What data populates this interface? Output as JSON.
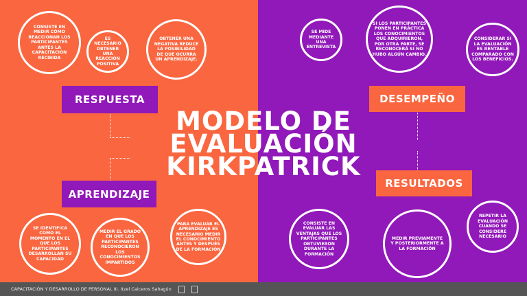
{
  "title": [
    "MODELO DE",
    "EVALUACIÓN",
    "KIRKPATRICK"
  ],
  "labels": {
    "respuesta": "RESPUESTA",
    "desempeno": "DESEMPEÑO",
    "aprendizaje": "APRENDIZAJE",
    "resultados": "RESULTADOS"
  },
  "respuesta": [
    "Consiste en medir cómo reaccionan los participantes antes la capacitación recibida",
    "Es necesario obtener una reacción positiva",
    "Obtener una negativa reduce la posibilidad de que ocurra un aprendizaje."
  ],
  "desempeno": [
    "Se mide mediante una entrevista",
    "Si los participantes ponen en práctica los conocimientos que adquirieron, por otra parte, se reconocerá si no hubo algún cambio.",
    "Considerar si la evaluación es rentable comparado con los beneficios."
  ],
  "aprendizaje": [
    "Se identifica como el momento en el que los participantes desarrollan su capacidad",
    "Medir el grado en que los participantes reconocieron los conocimientos impartidos",
    "Para evaluar el aprendizaje es necesario medir el conocimiento antes y después de la formación"
  ],
  "resultados": [
    "Consiste en evaluar las ventajas que los participantes obtuvieron durante la formación",
    "Medir previamente y posteriormente a la formación",
    "Repetir la evaluación cuando se considere necesario"
  ],
  "footer": "CAPACITACIÓN Y DESARROLLO DE PERSONAL III. Itzel Caiceros Sahagún",
  "colors": {
    "orange": "#F9663F",
    "purple": "#9118B9",
    "footer": "#555555"
  }
}
